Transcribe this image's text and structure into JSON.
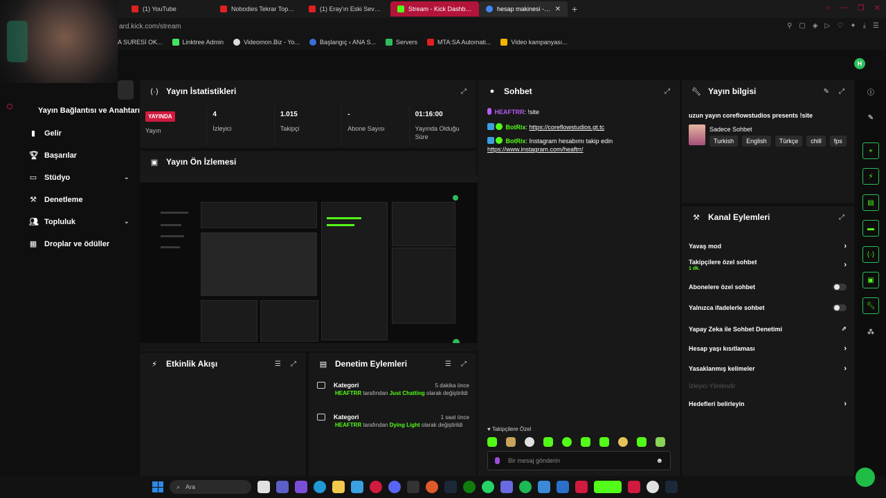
{
  "browser": {
    "tabs": [
      {
        "title": "(1) YouTube",
        "color": "#e02020",
        "active": false
      },
      {
        "title": "Nobodies Tekrar Toplanıyo",
        "color": "#e02020",
        "active": false
      },
      {
        "title": "(1) Eray'ın Eski Sevgilisi Ç",
        "color": "#e02020",
        "active": false
      },
      {
        "title": "Stream - Kick Dashboard",
        "color": "#53fc18",
        "active": true
      },
      {
        "title": "hesap makinesi - Goog",
        "color": "#4285f4",
        "active": false
      }
    ],
    "url": "ard.kick.com/stream",
    "bookmarks": [
      {
        "label": "A SURESİ OK...",
        "color": "#333333"
      },
      {
        "label": "Linktree Admin",
        "color": "#43e55e"
      },
      {
        "label": "Videomon.Biz - Yo...",
        "color": "#dddddd"
      },
      {
        "label": "Başlangıç ‹ ANA S...",
        "color": "#3a6ed8"
      },
      {
        "label": "Servers",
        "color": "#2dbd5a"
      },
      {
        "label": "MTA:SA Automati...",
        "color": "#e02020"
      },
      {
        "label": "Video kampanyası...",
        "color": "#f4b400"
      }
    ]
  },
  "user_avatar_letter": "H",
  "sidebar": {
    "title": "Yayın Bağlantısı ve Anahtarı",
    "items": [
      {
        "label": "Gelir",
        "icon": "chart-icon"
      },
      {
        "label": "Başarılar",
        "icon": "trophy-icon"
      },
      {
        "label": "Stüdyo",
        "icon": "monitor-icon",
        "expandable": true
      },
      {
        "label": "Denetleme",
        "icon": "hammer-icon"
      },
      {
        "label": "Topluluk",
        "icon": "users-icon",
        "expandable": true
      },
      {
        "label": "Droplar ve ödüller",
        "icon": "gift-icon"
      }
    ]
  },
  "stats": {
    "title": "Yayın İstatistikleri",
    "live_badge": "YAYINDA",
    "items": [
      {
        "value": "",
        "label": "Yayın"
      },
      {
        "value": "4",
        "label": "İzleyici"
      },
      {
        "value": "1.015",
        "label": "Takipçi"
      },
      {
        "value": "-",
        "label": "Abone Sayısı"
      },
      {
        "value": "01:16:00",
        "label": "Yayında Olduğu Süre"
      }
    ]
  },
  "preview": {
    "title": "Yayın Ön İzlemesi"
  },
  "activity": {
    "title": "Etkinlik Akışı"
  },
  "moderation": {
    "title": "Denetim Eylemleri",
    "items": [
      {
        "type": "Kategori",
        "time": "5 dakika önce",
        "user": "HEAFTRR",
        "middle": " tarafından ",
        "category": "Just Chatting",
        "suffix": " olarak değiştirildi"
      },
      {
        "type": "Kategori",
        "time": "1 saat önce",
        "user": "HEAFTRR",
        "middle": " tarafından ",
        "category": "Dying Light",
        "suffix": " olarak değiştirildi"
      }
    ]
  },
  "chat": {
    "title": "Sohbet",
    "messages": [
      {
        "user": "HEAFTRR",
        "user_color": "#b65cf2",
        "text": "!site",
        "link": ""
      },
      {
        "user": "BotRix",
        "user_color": "#53fc18",
        "text": "",
        "link": "https://coreflowstudios.gt.tc"
      },
      {
        "user": "BotRix",
        "user_color": "#53fc18",
        "text": "Instagram hesabımı takip edin",
        "link": "https://www.instagram.com/heaftrr/"
      }
    ],
    "followers_only": "Takipçilere Özel",
    "input_placeholder": "Bir mesaj gönderin"
  },
  "stream_info": {
    "title": "Yayın bilgisi",
    "stream_title": "uzun yayın coreflowstudios presents !site",
    "category": "Sadece Sohbet",
    "tags": [
      "Turkish",
      "English",
      "Türkçe",
      "chill",
      "fps"
    ]
  },
  "channel_actions": {
    "title": "Kanal Eylemleri",
    "items": [
      {
        "label": "Yavaş mod",
        "control": "chevron",
        "sub": ""
      },
      {
        "label": "Takipçilere özel sohbet",
        "control": "chevron",
        "sub": "1 dk."
      },
      {
        "label": "Abonelere özel sohbet",
        "control": "toggle",
        "sub": ""
      },
      {
        "label": "Yalnızca ifadelerle sohbet",
        "control": "toggle",
        "sub": ""
      },
      {
        "label": "Yapay Zeka ile Sohbet Denetimi",
        "control": "external",
        "sub": ""
      },
      {
        "label": "Hesap yaşı kısıtlaması",
        "control": "chevron",
        "sub": ""
      },
      {
        "label": "Yasaklanmış kelimeler",
        "control": "chevron",
        "sub": ""
      },
      {
        "label": "İzleyici Yönlendir",
        "control": "none",
        "sub": ""
      },
      {
        "label": "Hedefleri belirleyin",
        "control": "chevron",
        "sub": ""
      }
    ]
  },
  "taskbar": {
    "search_placeholder": "Ara"
  },
  "colors": {
    "accent": "#53fc18",
    "live": "#d01a3e",
    "panel": "#181818"
  }
}
